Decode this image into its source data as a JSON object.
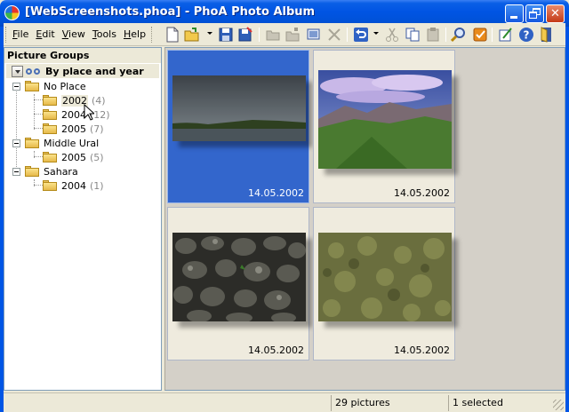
{
  "window": {
    "title": "[WebScreenshots.phoa] - PhoA Photo Album"
  },
  "menu": {
    "items": [
      "File",
      "Edit",
      "View",
      "Tools",
      "Help"
    ],
    "underline": [
      "F",
      "E",
      "V",
      "T",
      "H"
    ]
  },
  "toolbar": {
    "icons": [
      "new-icon",
      "open-icon",
      "save-icon",
      "save-as-icon",
      "add-group-icon",
      "new-group-icon",
      "edit-picture-icon",
      "delete-icon",
      "undo-icon",
      "cut-icon",
      "copy-icon",
      "paste-icon",
      "find-icon",
      "select-icon",
      "settings-icon",
      "help-icon",
      "exit-icon"
    ]
  },
  "left_pane": {
    "title": "Picture Groups",
    "view_name": "By place and year",
    "tree": [
      {
        "label": "No Place",
        "children": [
          {
            "label": "2002",
            "count": "(4)"
          },
          {
            "label": "2004",
            "count": "(12)"
          },
          {
            "label": "2005",
            "count": "(7)"
          }
        ]
      },
      {
        "label": "Middle Ural",
        "children": [
          {
            "label": "2005",
            "count": "(5)"
          }
        ]
      },
      {
        "label": "Sahara",
        "children": [
          {
            "label": "2004",
            "count": "(1)"
          }
        ]
      }
    ]
  },
  "thumbnails": [
    {
      "date": "14.05.2002",
      "selected": true,
      "subject": "lake-dusk"
    },
    {
      "date": "14.05.2002",
      "selected": false,
      "subject": "mountain-meadow"
    },
    {
      "date": "14.05.2002",
      "selected": false,
      "subject": "lichen-rocks"
    },
    {
      "date": "14.05.2002",
      "selected": false,
      "subject": "moss"
    }
  ],
  "status": {
    "pictures": "29 pictures",
    "selected": "1 selected"
  }
}
